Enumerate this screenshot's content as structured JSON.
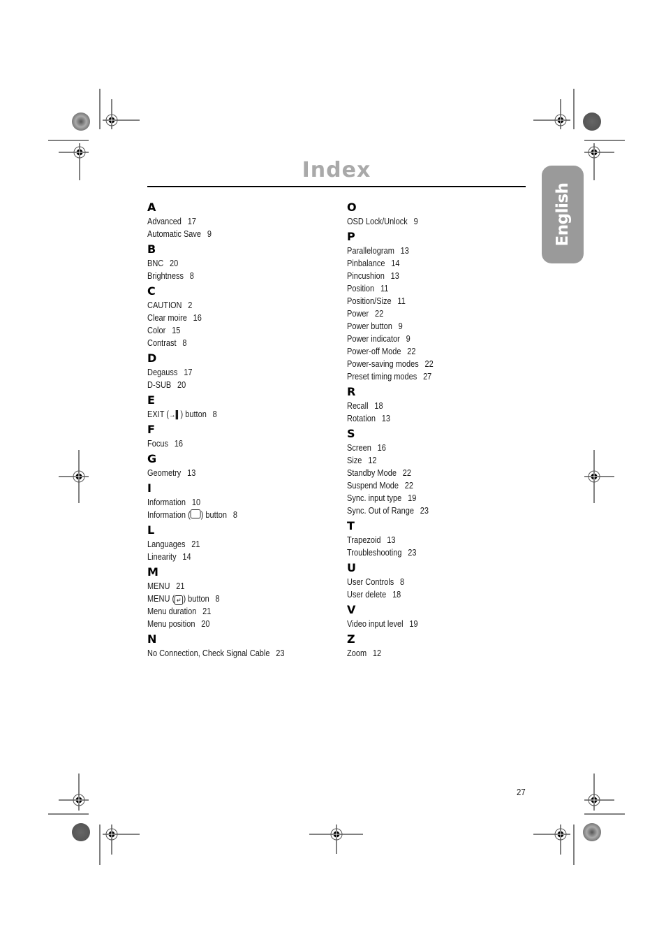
{
  "page": {
    "title": "Index",
    "language_tab": "English",
    "page_number": "27"
  },
  "index": {
    "left": [
      {
        "letter": "A",
        "entries": [
          {
            "term": "Advanced",
            "page": "17"
          },
          {
            "term": "Automatic Save",
            "page": "9"
          }
        ]
      },
      {
        "letter": "B",
        "entries": [
          {
            "term": "BNC",
            "page": "20"
          },
          {
            "term": "Brightness",
            "page": "8"
          }
        ]
      },
      {
        "letter": "C",
        "entries": [
          {
            "term": "CAUTION",
            "page": "2"
          },
          {
            "term": "Clear moire",
            "page": "16"
          },
          {
            "term": "Color",
            "page": "15"
          },
          {
            "term": "Contrast",
            "page": "8"
          }
        ]
      },
      {
        "letter": "D",
        "entries": [
          {
            "term": "Degauss",
            "page": "17"
          },
          {
            "term": "D-SUB",
            "page": "20"
          }
        ]
      },
      {
        "letter": "E",
        "entries": [
          {
            "term": "EXIT (",
            "icon": "exit-icon",
            "term_after": ") button",
            "page": "8"
          }
        ]
      },
      {
        "letter": "F",
        "entries": [
          {
            "term": "Focus",
            "page": "16"
          }
        ]
      },
      {
        "letter": "G",
        "entries": [
          {
            "term": "Geometry",
            "page": "13"
          }
        ]
      },
      {
        "letter": "I",
        "entries": [
          {
            "term": "Information",
            "page": "10"
          },
          {
            "term": "Information (",
            "icon": "information-button-icon",
            "term_after": ") button",
            "page": "8"
          }
        ]
      },
      {
        "letter": "L",
        "entries": [
          {
            "term": "Languages",
            "page": "21"
          },
          {
            "term": "Linearity",
            "page": "14"
          }
        ]
      },
      {
        "letter": "M",
        "entries": [
          {
            "term": "MENU",
            "page": "21"
          },
          {
            "term": "MENU (",
            "icon": "menu-enter-icon",
            "term_after": ") button",
            "page": "8"
          },
          {
            "term": "Menu duration",
            "page": "21"
          },
          {
            "term": "Menu position",
            "page": "20"
          }
        ]
      },
      {
        "letter": "N",
        "entries": [
          {
            "term": "No Connection, Check Signal Cable",
            "page": "23"
          }
        ]
      }
    ],
    "right": [
      {
        "letter": "O",
        "entries": [
          {
            "term": "OSD Lock/Unlock",
            "page": "9"
          }
        ]
      },
      {
        "letter": "P",
        "entries": [
          {
            "term": "Parallelogram",
            "page": "13"
          },
          {
            "term": "Pinbalance",
            "page": "14"
          },
          {
            "term": "Pincushion",
            "page": "13"
          },
          {
            "term": "Position",
            "page": "11"
          },
          {
            "term": "Position/Size",
            "page": "11"
          },
          {
            "term": "Power",
            "page": "22"
          },
          {
            "term": "Power button",
            "page": "9"
          },
          {
            "term": "Power indicator",
            "page": "9"
          },
          {
            "term": "Power-off Mode",
            "page": "22"
          },
          {
            "term": "Power-saving modes",
            "page": "22"
          },
          {
            "term": "Preset timing modes",
            "page": "27"
          }
        ]
      },
      {
        "letter": "R",
        "entries": [
          {
            "term": "Recall",
            "page": "18"
          },
          {
            "term": "Rotation",
            "page": "13"
          }
        ]
      },
      {
        "letter": "S",
        "entries": [
          {
            "term": "Screen",
            "page": "16"
          },
          {
            "term": "Size",
            "page": "12"
          },
          {
            "term": "Standby Mode",
            "page": "22"
          },
          {
            "term": "Suspend Mode",
            "page": "22"
          },
          {
            "term": "Sync. input type",
            "page": "19"
          },
          {
            "term": "Sync. Out of Range",
            "page": "23"
          }
        ]
      },
      {
        "letter": "T",
        "entries": [
          {
            "term": "Trapezoid",
            "page": "13"
          },
          {
            "term": "Troubleshooting",
            "page": "23"
          }
        ]
      },
      {
        "letter": "U",
        "entries": [
          {
            "term": "User Controls",
            "page": "8"
          },
          {
            "term": "User delete",
            "page": "18"
          }
        ]
      },
      {
        "letter": "V",
        "entries": [
          {
            "term": "Video input level",
            "page": "19"
          }
        ]
      },
      {
        "letter": "Z",
        "entries": [
          {
            "term": "Zoom",
            "page": "12"
          }
        ]
      }
    ]
  },
  "icons": {
    "exit-icon": "→▌",
    "menu-enter-icon": "↵"
  }
}
